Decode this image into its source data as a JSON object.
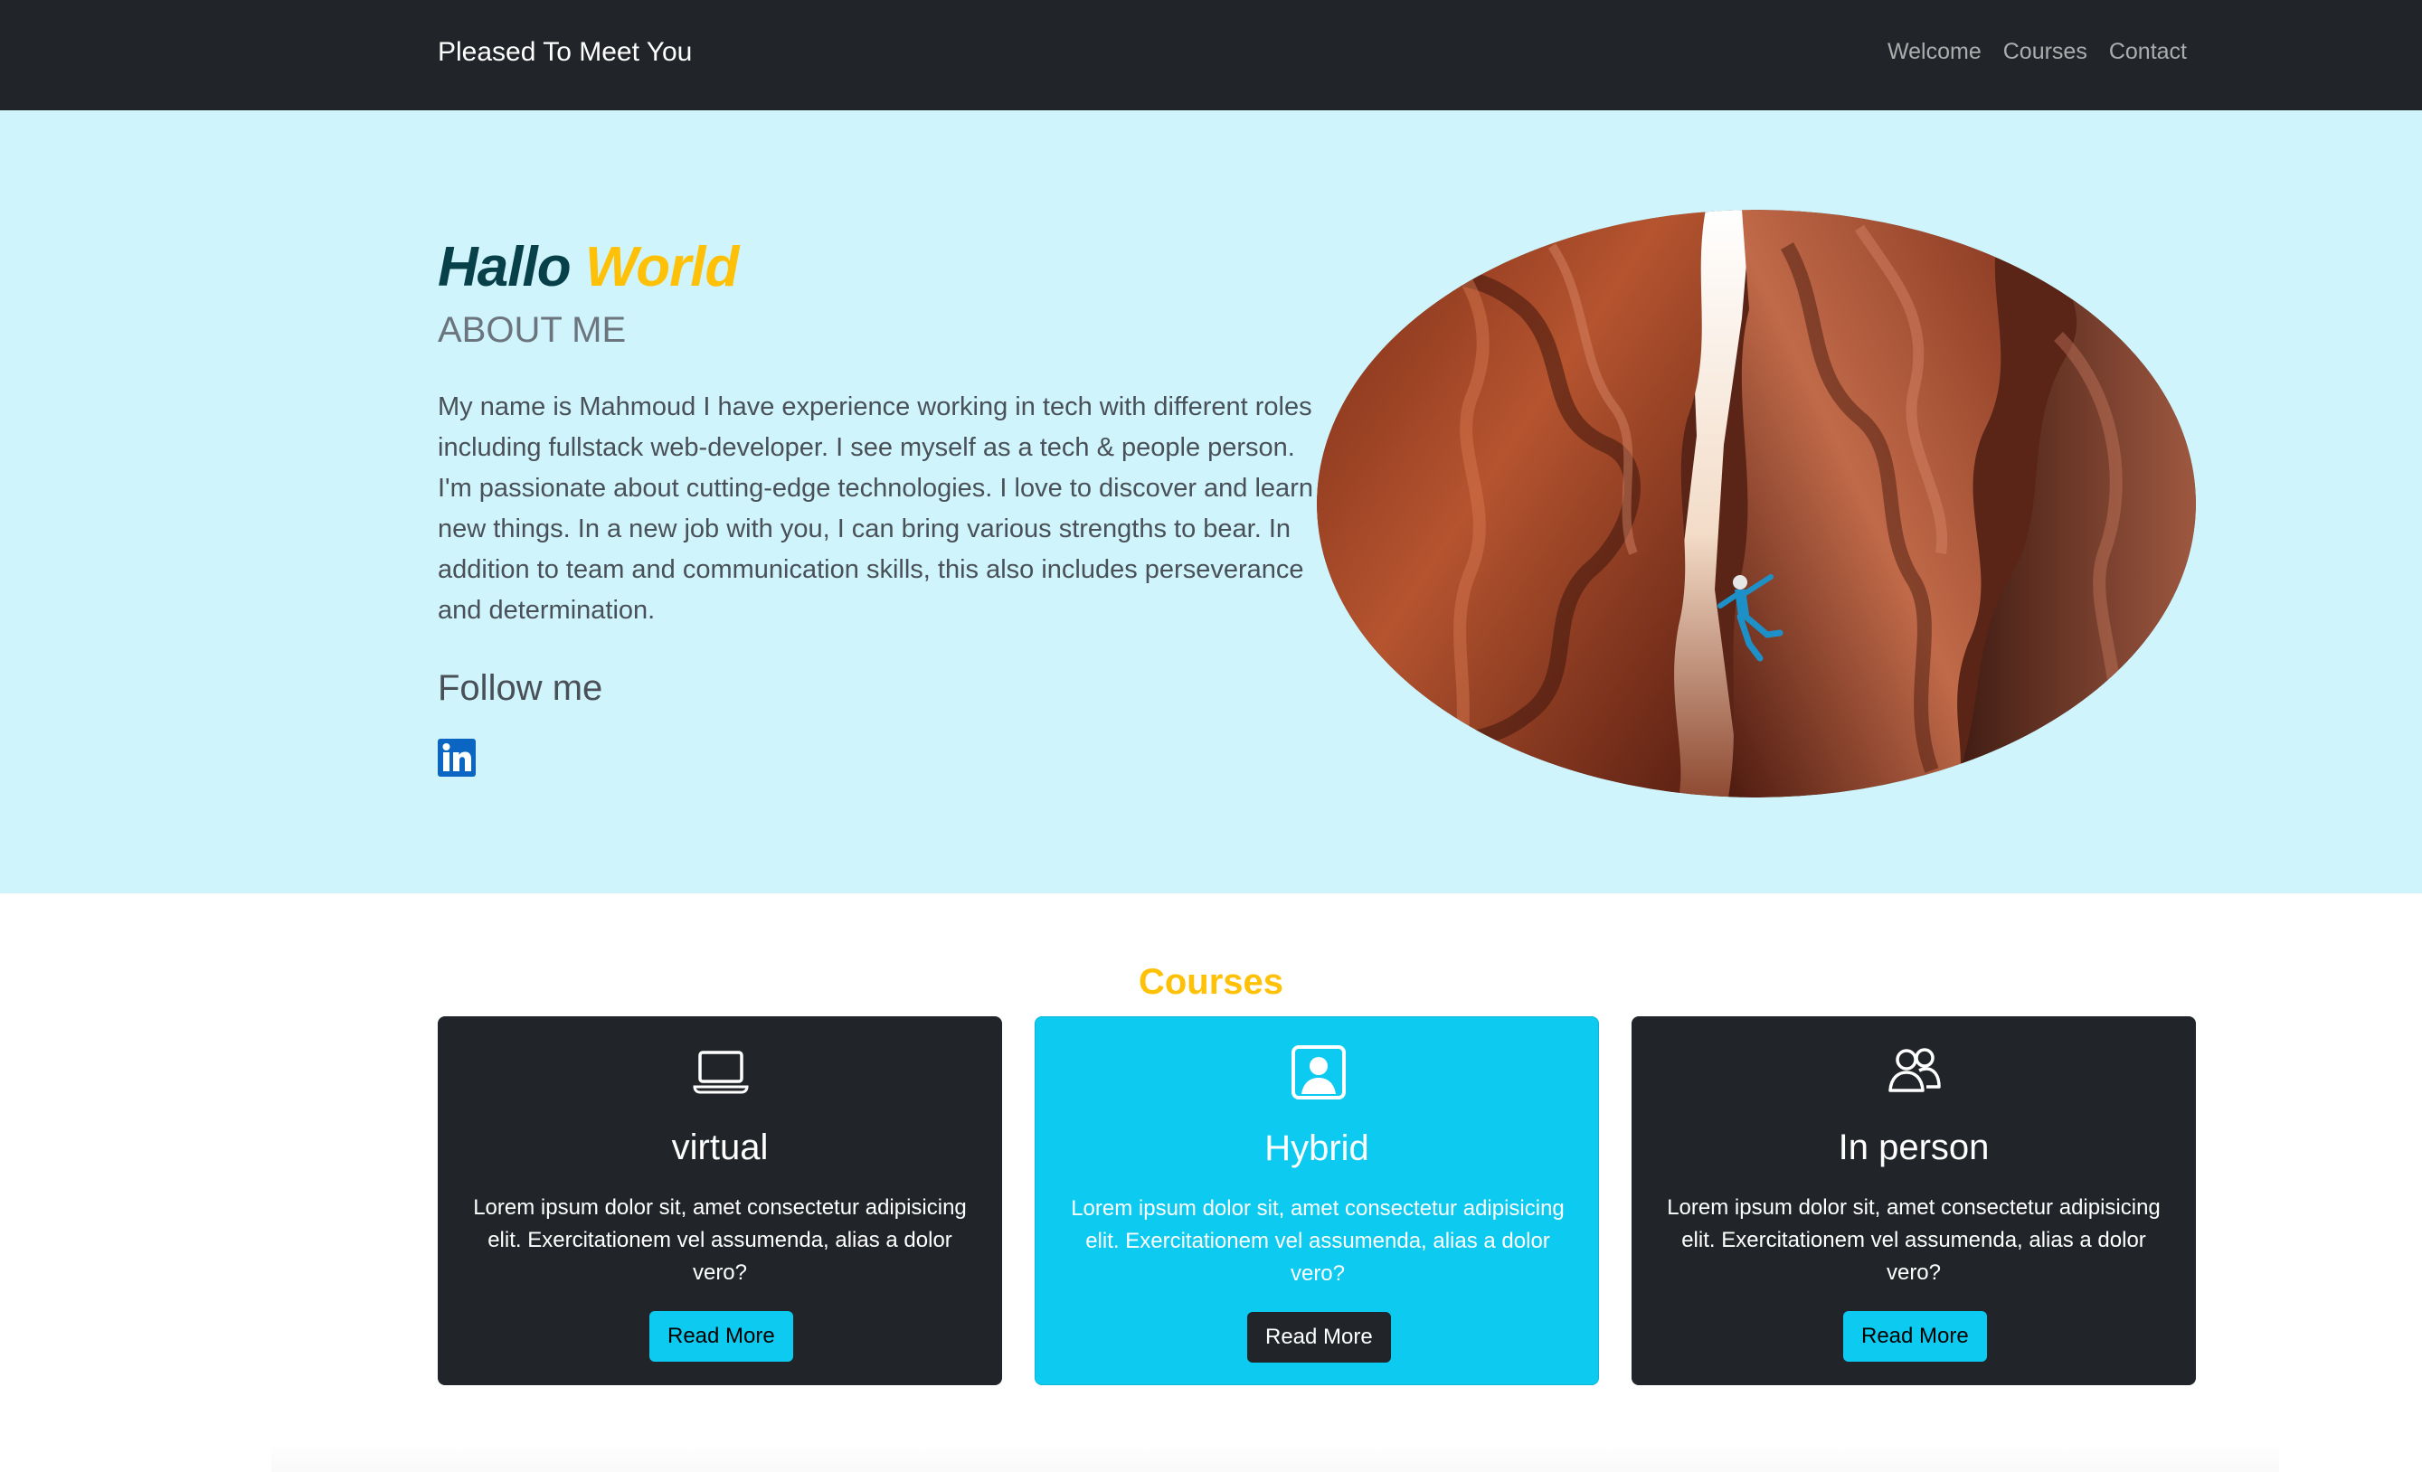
{
  "navbar": {
    "brand": "Pleased To Meet You",
    "links": [
      "Welcome",
      "Courses",
      "Contact"
    ]
  },
  "hero": {
    "title_part1": "Hallo",
    "title_part2": "World",
    "subtitle": "ABOUT ME",
    "about_text": "My name is Mahmoud I have experience working in tech with different roles including fullstack web-developer. I see myself as a tech & people person. I'm passionate about cutting-edge technologies. I love to discover and learn new things. In a new job with you, I can bring various strengths to bear. In addition to team and communication skills, this also includes perseverance and determination.",
    "follow_heading": "Follow me",
    "social_icon": "linkedin-icon",
    "image": "canyon-climber-photo"
  },
  "courses": {
    "title": "Courses",
    "cards": [
      {
        "icon": "laptop-icon",
        "title": "virtual",
        "text": "Lorem ipsum dolor sit, amet consectetur adipisicing elit. Exercitationem vel assumenda, alias a dolor vero?",
        "button": "Read More",
        "theme": "dark"
      },
      {
        "icon": "person-badge-icon",
        "title": "Hybrid",
        "text": "Lorem ipsum dolor sit, amet consectetur adipisicing elit. Exercitationem vel assumenda, alias a dolor vero?",
        "button": "Read More",
        "theme": "info"
      },
      {
        "icon": "people-icon",
        "title": "In person",
        "text": "Lorem ipsum dolor sit, amet consectetur adipisicing elit. Exercitationem vel assumenda, alias a dolor vero?",
        "button": "Read More",
        "theme": "dark"
      }
    ]
  },
  "colors": {
    "navbar_bg": "#212529",
    "hero_bg": "#cff4fc",
    "accent_yellow": "#ffc107",
    "accent_cyan": "#0dcaf0",
    "hello_teal": "#074048",
    "linkedin_blue": "#0a66c2"
  }
}
